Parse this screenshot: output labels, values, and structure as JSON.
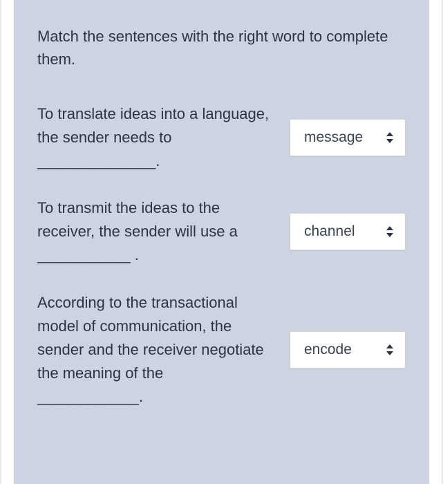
{
  "instructions": "Match the sentences with the right word to complete them.",
  "items": [
    {
      "prompt": "To translate ideas into a language, the sender needs to ______________.",
      "selected": "message"
    },
    {
      "prompt": "To transmit the ideas to the receiver, the sender will use a ___________ .",
      "selected": "channel"
    },
    {
      "prompt": "According to the transactional model of communication, the sender and the receiver negotiate the meaning of the ____________.",
      "selected": "encode"
    }
  ]
}
